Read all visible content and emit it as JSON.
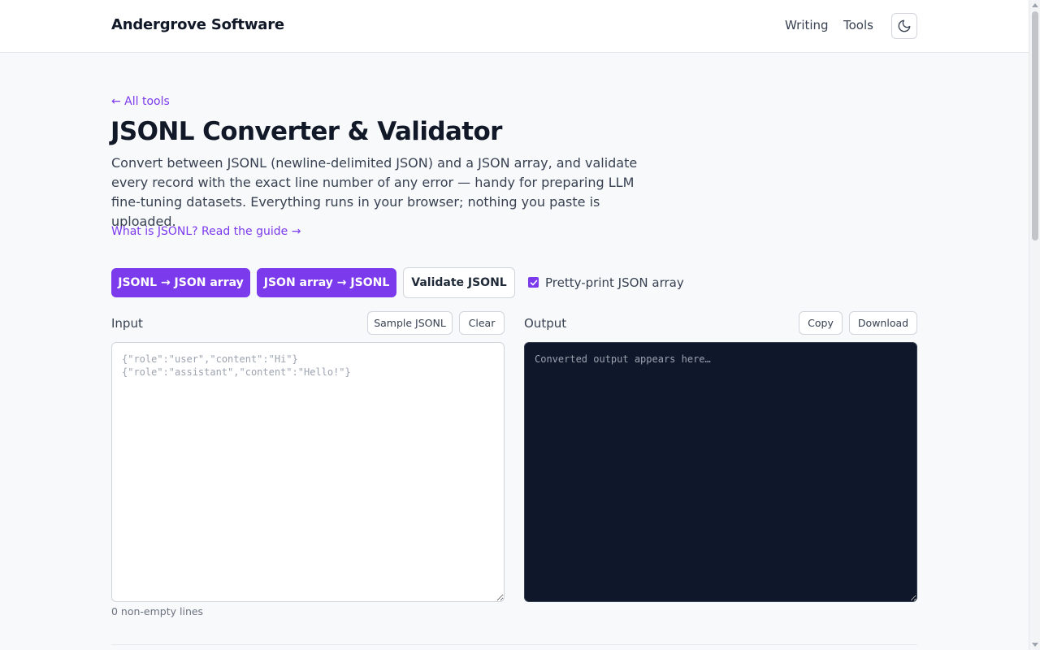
{
  "header": {
    "brand": "Andergrove Software",
    "nav": [
      {
        "label": "Writing"
      },
      {
        "label": "Tools"
      }
    ],
    "theme_toggle_icon": "moon-icon"
  },
  "page": {
    "back_link": "← All tools",
    "title": "JSONL Converter & Validator",
    "intro": "Convert between JSONL (newline-delimited JSON) and a JSON array, and validate every record with the exact line number of any error — handy for preparing LLM fine-tuning datasets. Everything runs in your browser; nothing you paste is uploaded.",
    "guide_link": "What is JSONL? Read the guide →"
  },
  "actions": {
    "jsonl_to_array": "JSONL → JSON array",
    "array_to_jsonl": "JSON array → JSONL",
    "validate": "Validate JSONL",
    "pretty_print_label": "Pretty-print JSON array",
    "pretty_print_checked": true
  },
  "input_panel": {
    "label": "Input",
    "sample_button": "Sample JSONL",
    "clear_button": "Clear",
    "placeholder": "{\"role\":\"user\",\"content\":\"Hi\"}\n{\"role\":\"assistant\",\"content\":\"Hello!\"}",
    "value": "",
    "line_count": "0 non-empty lines"
  },
  "output_panel": {
    "label": "Output",
    "copy_button": "Copy",
    "download_button": "Download",
    "placeholder": "Converted output appears here…",
    "value": ""
  },
  "colors": {
    "accent": "#7c3aed",
    "output_bg": "#0f172a",
    "page_bg": "#f8f9fb"
  }
}
